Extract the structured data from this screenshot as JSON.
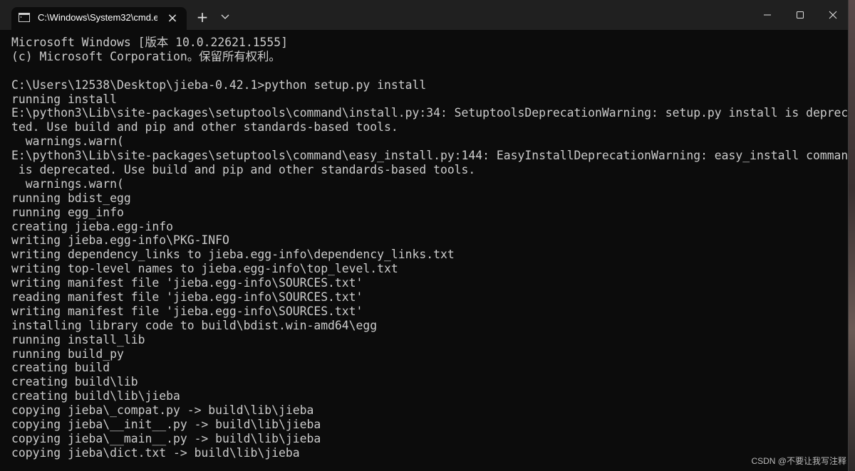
{
  "window": {
    "tab_title": "C:\\Windows\\System32\\cmd.e",
    "new_tab_symbol": "+",
    "tab_close_symbol": "×"
  },
  "console": {
    "lines": [
      "Microsoft Windows [版本 10.0.22621.1555]",
      "(c) Microsoft Corporation。保留所有权利。",
      "",
      "C:\\Users\\12538\\Desktop\\jieba-0.42.1>python setup.py install",
      "running install",
      "E:\\python3\\Lib\\site-packages\\setuptools\\command\\install.py:34: SetuptoolsDeprecationWarning: setup.py install is depreca",
      "ted. Use build and pip and other standards-based tools.",
      "  warnings.warn(",
      "E:\\python3\\Lib\\site-packages\\setuptools\\command\\easy_install.py:144: EasyInstallDeprecationWarning: easy_install command",
      " is deprecated. Use build and pip and other standards-based tools.",
      "  warnings.warn(",
      "running bdist_egg",
      "running egg_info",
      "creating jieba.egg-info",
      "writing jieba.egg-info\\PKG-INFO",
      "writing dependency_links to jieba.egg-info\\dependency_links.txt",
      "writing top-level names to jieba.egg-info\\top_level.txt",
      "writing manifest file 'jieba.egg-info\\SOURCES.txt'",
      "reading manifest file 'jieba.egg-info\\SOURCES.txt'",
      "writing manifest file 'jieba.egg-info\\SOURCES.txt'",
      "installing library code to build\\bdist.win-amd64\\egg",
      "running install_lib",
      "running build_py",
      "creating build",
      "creating build\\lib",
      "creating build\\lib\\jieba",
      "copying jieba\\_compat.py -> build\\lib\\jieba",
      "copying jieba\\__init__.py -> build\\lib\\jieba",
      "copying jieba\\__main__.py -> build\\lib\\jieba",
      "copying jieba\\dict.txt -> build\\lib\\jieba"
    ]
  },
  "watermark": "CSDN @不要让我写注释",
  "colors": {
    "console_bg": "#0c0c0c",
    "console_text": "#cccccc",
    "titlebar_bg": "#202020"
  },
  "icons": {
    "tab_icon": "terminal-icon",
    "dropdown": "chevron-down-icon",
    "minimize": "minimize-icon",
    "maximize": "maximize-icon",
    "close": "close-icon"
  }
}
